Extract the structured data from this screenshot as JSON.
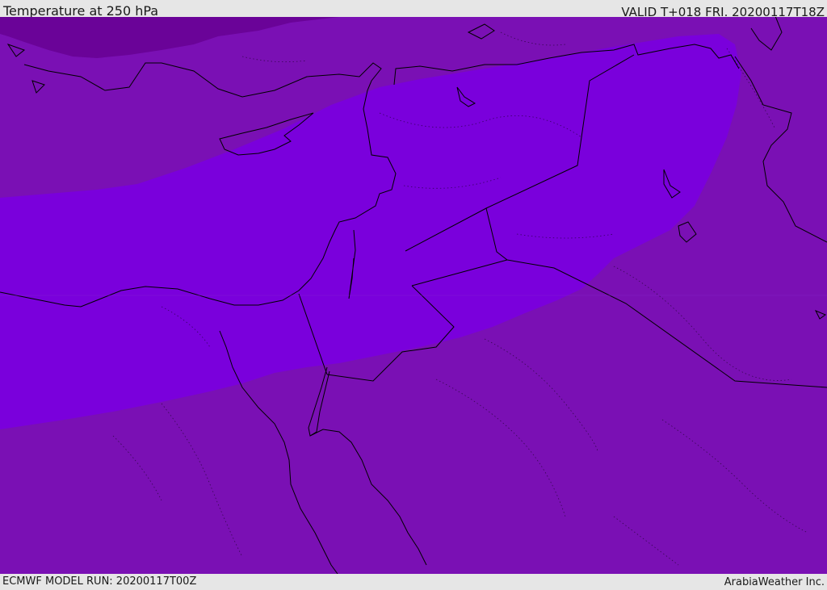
{
  "header": {
    "title": "Temperature at 250 hPa",
    "valid": "VALID T+018 FRI. 20200117T18Z"
  },
  "footer": {
    "model_run": "ECMWF MODEL RUN: 20200117T00Z",
    "credit": "ArabiaWeather Inc."
  },
  "map": {
    "colors": {
      "background_zone": "#7a10b4",
      "cold_core": "#7a00dc",
      "northern_dark": "#6a0398",
      "coastline": "#000000"
    }
  }
}
